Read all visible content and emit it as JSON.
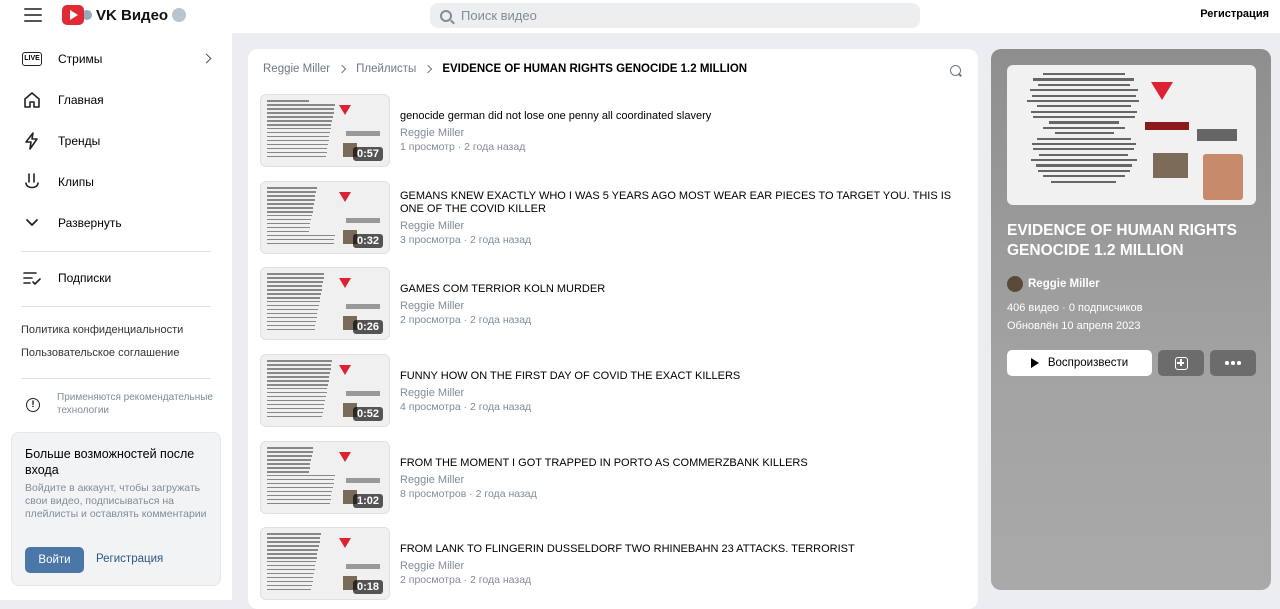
{
  "header": {
    "logo_text": "VK Видео",
    "search_placeholder": "Поиск видео",
    "register_label": "Регистрация"
  },
  "sidebar": {
    "items": [
      {
        "label": "Стримы",
        "icon": "live-icon"
      },
      {
        "label": "Главная",
        "icon": "home-icon"
      },
      {
        "label": "Тренды",
        "icon": "lightning-icon"
      },
      {
        "label": "Клипы",
        "icon": "clips-icon"
      },
      {
        "label": "Развернуть",
        "icon": "chevron-down-icon"
      }
    ],
    "subscriptions_label": "Подписки",
    "live_badge": "LIVE",
    "privacy_policy": "Политика конфиденциальности",
    "user_agreement": "Пользовательское соглашение",
    "recommendation_note": "Применяются рекомендательные технологии",
    "login_card": {
      "title": "Больше возможностей после входа",
      "description": "Войдите в аккаунт, чтобы загружать свои видео, подписываться на плейлисты и оставлять комментарии",
      "login_button": "Войти",
      "register_button": "Регистрация"
    }
  },
  "breadcrumb": {
    "channel": "Reggie Miller",
    "section": "Плейлисты",
    "current": "EVIDENCE OF HUMAN RIGHTS GENOCIDE 1.2 MILLION"
  },
  "videos": [
    {
      "title": "genocide german did not lose one penny all coordinated slavery",
      "author": "Reggie Miller",
      "meta": "1 просмотр · 2 года назад",
      "duration": "0:57"
    },
    {
      "title": "GEMANS KNEW EXACTLY WHO I WAS 5 YEARS AGO MOST WEAR EAR PIECES TO TARGET YOU. THIS IS ONE OF THE COVID KILLER",
      "author": "Reggie Miller",
      "meta": "3 просмотра · 2 года назад",
      "duration": "0:32"
    },
    {
      "title": "GAMES COM TERRIOR KOLN MURDER",
      "author": "Reggie Miller",
      "meta": "2 просмотра · 2 года назад",
      "duration": "0:26"
    },
    {
      "title": "FUNNY HOW ON THE FIRST DAY OF COVID THE EXACT KILLERS",
      "author": "Reggie Miller",
      "meta": "4 просмотра · 2 года назад",
      "duration": "0:52"
    },
    {
      "title": "FROM THE MOMENT I GOT TRAPPED IN PORTO AS COMMERZBANK KILLERS",
      "author": "Reggie Miller",
      "meta": "8 просмотров · 2 года назад",
      "duration": "1:02"
    },
    {
      "title": "FROM LANK TO FLINGERIN DUSSELDORF TWO RHINEBAHN 23 ATTACKS. TERRORIST",
      "author": "Reggie Miller",
      "meta": "2 просмотра · 2 года назад",
      "duration": "0:18"
    }
  ],
  "playlist": {
    "title": "EVIDENCE OF HUMAN RIGHTS GENOCIDE 1.2 MILLION",
    "author": "Reggie Miller",
    "stats": "406 видео · 0 подписчиков",
    "updated": "Обновлён 10 апреля 2023",
    "play_label": "Воспроизвести"
  },
  "colors": {
    "accent": "#4a76a8",
    "page_bg": "#ebedf0",
    "panel_bg": "#9a9a9a"
  }
}
